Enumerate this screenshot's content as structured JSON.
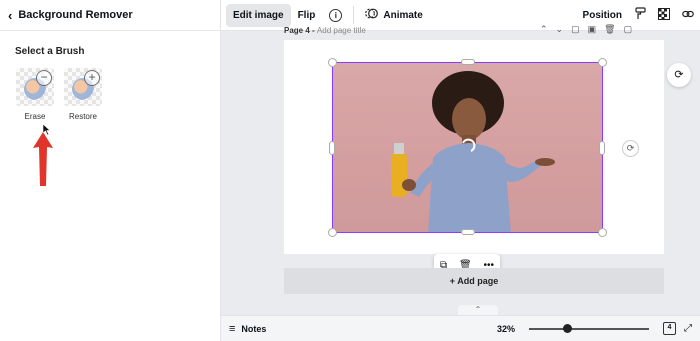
{
  "panel": {
    "title": "Background Remover",
    "section_title": "Select a Brush",
    "brushes": [
      {
        "label": "Erase",
        "icon": "minus-circle-icon",
        "glyph": "−"
      },
      {
        "label": "Restore",
        "icon": "plus-circle-icon",
        "glyph": "+"
      }
    ]
  },
  "toolbar": {
    "edit_image": "Edit image",
    "flip": "Flip",
    "info_glyph": "i",
    "animate": "Animate",
    "position": "Position"
  },
  "canvas": {
    "page_label": "Page 4 -",
    "page_title_placeholder": "Add page title",
    "add_page": "+ Add page"
  },
  "bottom": {
    "notes": "Notes",
    "zoom": "32%",
    "zoom_fraction": 0.32,
    "page_count": "4"
  },
  "colors": {
    "selection": "#8b3dff",
    "photo_bg": "#d9a8a8",
    "arrow": "#e0352b"
  }
}
